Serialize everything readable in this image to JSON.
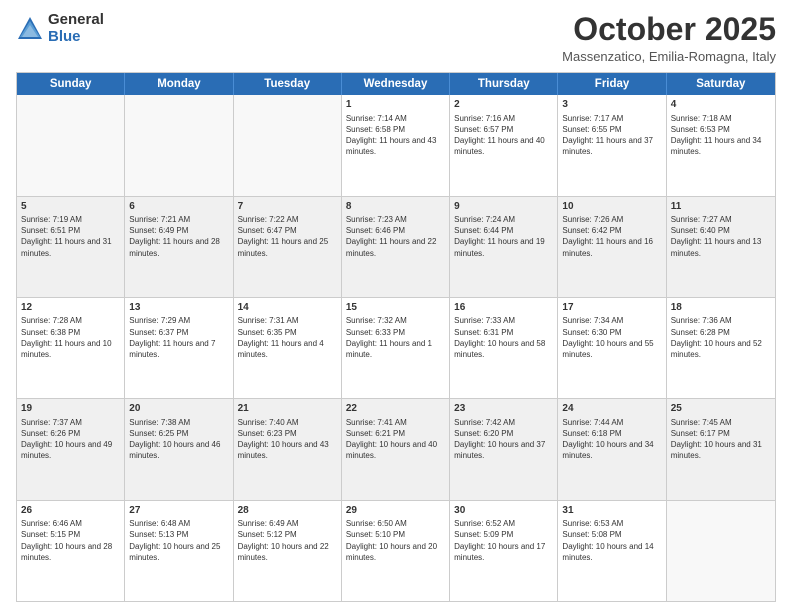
{
  "header": {
    "logo_general": "General",
    "logo_blue": "Blue",
    "month_title": "October 2025",
    "location": "Massenzatico, Emilia-Romagna, Italy"
  },
  "days_of_week": [
    "Sunday",
    "Monday",
    "Tuesday",
    "Wednesday",
    "Thursday",
    "Friday",
    "Saturday"
  ],
  "weeks": [
    {
      "cells": [
        {
          "day": "",
          "empty": true
        },
        {
          "day": "",
          "empty": true
        },
        {
          "day": "",
          "empty": true
        },
        {
          "day": "1",
          "sunrise": "7:14 AM",
          "sunset": "6:58 PM",
          "daylight": "11 hours and 43 minutes."
        },
        {
          "day": "2",
          "sunrise": "7:16 AM",
          "sunset": "6:57 PM",
          "daylight": "11 hours and 40 minutes."
        },
        {
          "day": "3",
          "sunrise": "7:17 AM",
          "sunset": "6:55 PM",
          "daylight": "11 hours and 37 minutes."
        },
        {
          "day": "4",
          "sunrise": "7:18 AM",
          "sunset": "6:53 PM",
          "daylight": "11 hours and 34 minutes."
        }
      ]
    },
    {
      "cells": [
        {
          "day": "5",
          "sunrise": "7:19 AM",
          "sunset": "6:51 PM",
          "daylight": "11 hours and 31 minutes."
        },
        {
          "day": "6",
          "sunrise": "7:21 AM",
          "sunset": "6:49 PM",
          "daylight": "11 hours and 28 minutes."
        },
        {
          "day": "7",
          "sunrise": "7:22 AM",
          "sunset": "6:47 PM",
          "daylight": "11 hours and 25 minutes."
        },
        {
          "day": "8",
          "sunrise": "7:23 AM",
          "sunset": "6:46 PM",
          "daylight": "11 hours and 22 minutes."
        },
        {
          "day": "9",
          "sunrise": "7:24 AM",
          "sunset": "6:44 PM",
          "daylight": "11 hours and 19 minutes."
        },
        {
          "day": "10",
          "sunrise": "7:26 AM",
          "sunset": "6:42 PM",
          "daylight": "11 hours and 16 minutes."
        },
        {
          "day": "11",
          "sunrise": "7:27 AM",
          "sunset": "6:40 PM",
          "daylight": "11 hours and 13 minutes."
        }
      ]
    },
    {
      "cells": [
        {
          "day": "12",
          "sunrise": "7:28 AM",
          "sunset": "6:38 PM",
          "daylight": "11 hours and 10 minutes."
        },
        {
          "day": "13",
          "sunrise": "7:29 AM",
          "sunset": "6:37 PM",
          "daylight": "11 hours and 7 minutes."
        },
        {
          "day": "14",
          "sunrise": "7:31 AM",
          "sunset": "6:35 PM",
          "daylight": "11 hours and 4 minutes."
        },
        {
          "day": "15",
          "sunrise": "7:32 AM",
          "sunset": "6:33 PM",
          "daylight": "11 hours and 1 minute."
        },
        {
          "day": "16",
          "sunrise": "7:33 AM",
          "sunset": "6:31 PM",
          "daylight": "10 hours and 58 minutes."
        },
        {
          "day": "17",
          "sunrise": "7:34 AM",
          "sunset": "6:30 PM",
          "daylight": "10 hours and 55 minutes."
        },
        {
          "day": "18",
          "sunrise": "7:36 AM",
          "sunset": "6:28 PM",
          "daylight": "10 hours and 52 minutes."
        }
      ]
    },
    {
      "cells": [
        {
          "day": "19",
          "sunrise": "7:37 AM",
          "sunset": "6:26 PM",
          "daylight": "10 hours and 49 minutes."
        },
        {
          "day": "20",
          "sunrise": "7:38 AM",
          "sunset": "6:25 PM",
          "daylight": "10 hours and 46 minutes."
        },
        {
          "day": "21",
          "sunrise": "7:40 AM",
          "sunset": "6:23 PM",
          "daylight": "10 hours and 43 minutes."
        },
        {
          "day": "22",
          "sunrise": "7:41 AM",
          "sunset": "6:21 PM",
          "daylight": "10 hours and 40 minutes."
        },
        {
          "day": "23",
          "sunrise": "7:42 AM",
          "sunset": "6:20 PM",
          "daylight": "10 hours and 37 minutes."
        },
        {
          "day": "24",
          "sunrise": "7:44 AM",
          "sunset": "6:18 PM",
          "daylight": "10 hours and 34 minutes."
        },
        {
          "day": "25",
          "sunrise": "7:45 AM",
          "sunset": "6:17 PM",
          "daylight": "10 hours and 31 minutes."
        }
      ]
    },
    {
      "cells": [
        {
          "day": "26",
          "sunrise": "6:46 AM",
          "sunset": "5:15 PM",
          "daylight": "10 hours and 28 minutes."
        },
        {
          "day": "27",
          "sunrise": "6:48 AM",
          "sunset": "5:13 PM",
          "daylight": "10 hours and 25 minutes."
        },
        {
          "day": "28",
          "sunrise": "6:49 AM",
          "sunset": "5:12 PM",
          "daylight": "10 hours and 22 minutes."
        },
        {
          "day": "29",
          "sunrise": "6:50 AM",
          "sunset": "5:10 PM",
          "daylight": "10 hours and 20 minutes."
        },
        {
          "day": "30",
          "sunrise": "6:52 AM",
          "sunset": "5:09 PM",
          "daylight": "10 hours and 17 minutes."
        },
        {
          "day": "31",
          "sunrise": "6:53 AM",
          "sunset": "5:08 PM",
          "daylight": "10 hours and 14 minutes."
        },
        {
          "day": "",
          "empty": true
        }
      ]
    }
  ]
}
